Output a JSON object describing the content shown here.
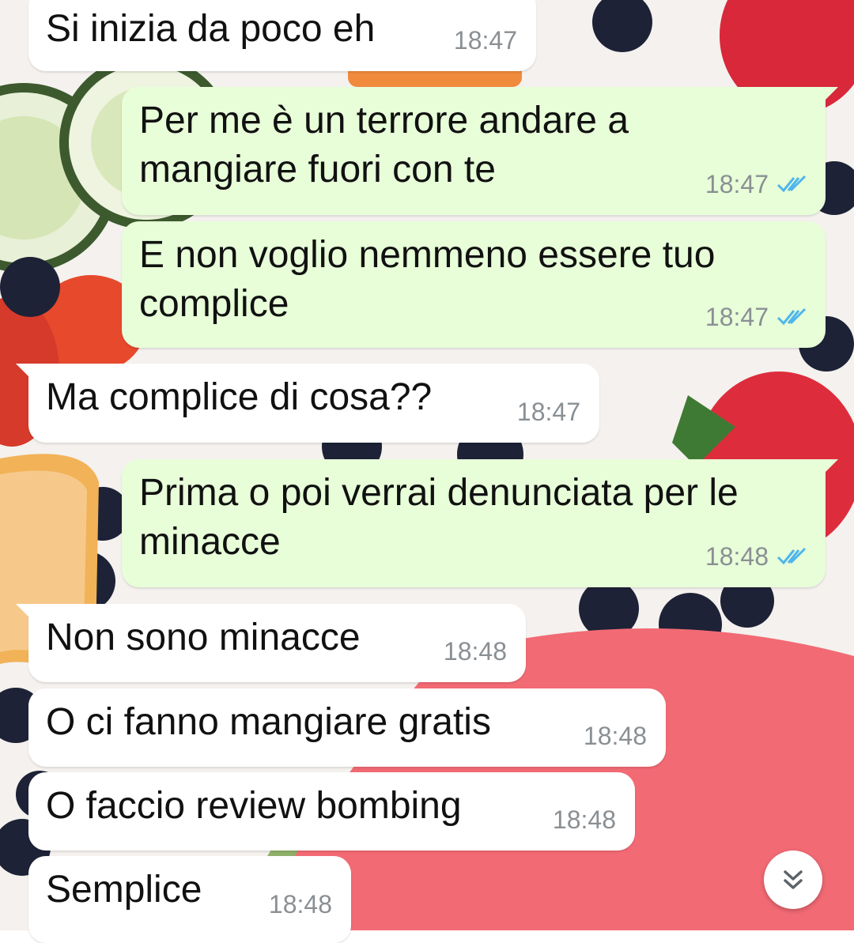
{
  "chat": {
    "messages": [
      {
        "direction": "incoming",
        "text": "Si inizia da poco eh",
        "time": "18:47",
        "read": false
      },
      {
        "direction": "outgoing",
        "text": "Per me è un terrore andare a\nmangiare fuori con te",
        "time": "18:47",
        "read": true
      },
      {
        "direction": "outgoing",
        "text": "E non voglio nemmeno essere tuo\ncomplice",
        "time": "18:47",
        "read": true
      },
      {
        "direction": "incoming",
        "text": "Ma complice di cosa??",
        "time": "18:47",
        "read": false
      },
      {
        "direction": "outgoing",
        "text": "Prima o poi verrai denunciata per le\nminacce",
        "time": "18:48",
        "read": true
      },
      {
        "direction": "incoming",
        "text": "Non sono minacce",
        "time": "18:48",
        "read": false
      },
      {
        "direction": "incoming",
        "text": "O ci fanno mangiare gratis",
        "time": "18:48",
        "read": false
      },
      {
        "direction": "incoming",
        "text": "O faccio review bombing",
        "time": "18:48",
        "read": false
      },
      {
        "direction": "incoming",
        "text": "Semplice",
        "time": "18:48",
        "read": false
      }
    ]
  },
  "icons": {
    "read_receipt": "double-check-icon",
    "scroll_down": "chevron-double-down-icon",
    "wallpaper": "fruit-wallpaper"
  },
  "colors": {
    "incoming_bubble": "#ffffff",
    "outgoing_bubble": "#e7fed8",
    "timestamp": "#8a8f93",
    "read_ticks": "#4fb6ec"
  }
}
